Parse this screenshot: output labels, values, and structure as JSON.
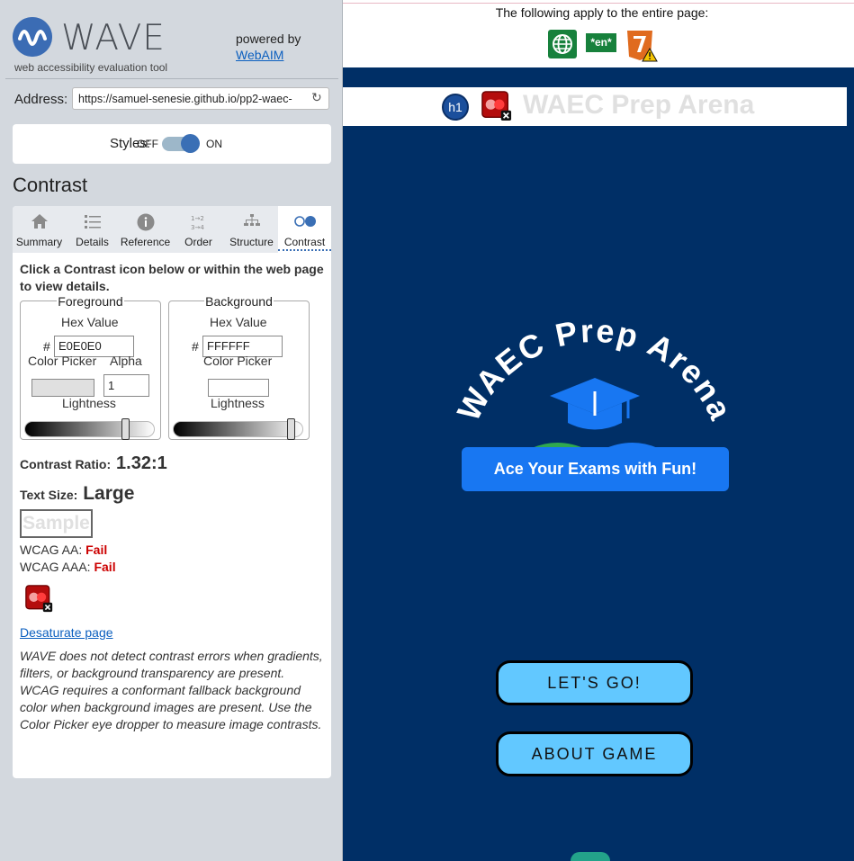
{
  "wave": {
    "logo_text": "WAVE",
    "tagline": "web accessibility evaluation tool",
    "powered_by": "powered by",
    "webaim_link": "WebAIM",
    "address_label": "Address:",
    "address_value": "https://samuel-senesie.github.io/pp2-waec-",
    "styles_label": "Styles:",
    "styles_off": "OFF",
    "styles_on": "ON",
    "panel_title": "Contrast",
    "tabs": [
      {
        "label": "Summary",
        "icon": "home-icon"
      },
      {
        "label": "Details",
        "icon": "list-icon"
      },
      {
        "label": "Reference",
        "icon": "info-icon"
      },
      {
        "label": "Order",
        "icon": "order-icon"
      },
      {
        "label": "Structure",
        "icon": "structure-icon"
      },
      {
        "label": "Contrast",
        "icon": "contrast-icon",
        "active": true
      }
    ],
    "intro": "Click a Contrast icon below or within the web page to view details.",
    "foreground": {
      "legend": "Foreground",
      "hex_label": "Hex Value",
      "hex_value": "E0E0E0",
      "picker_label": "Color Picker",
      "alpha_label": "Alpha",
      "alpha_value": "1",
      "lightness_label": "Lightness",
      "lightness": 0.8,
      "swatch_color": "#e0e0e0"
    },
    "background": {
      "legend": "Background",
      "hex_label": "Hex Value",
      "hex_value": "FFFFFF",
      "picker_label": "Color Picker",
      "lightness_label": "Lightness",
      "lightness": 0.94,
      "swatch_color": "#ffffff"
    },
    "hash": "#",
    "contrast_ratio_label": "Contrast Ratio:",
    "contrast_ratio_value": "1.32:1",
    "text_size_label": "Text Size:",
    "text_size_value": "Large",
    "sample_text": "Sample",
    "wcag_aa_label": "WCAG AA:",
    "wcag_aa_result": "Fail",
    "wcag_aaa_label": "WCAG AAA:",
    "wcag_aaa_result": "Fail",
    "desaturate_link": "Desaturate page",
    "note": "WAVE does not detect contrast errors when gradients, filters, or background transparency are present. WCAG requires a conformant fallback background color when background images are present. Use the Color Picker eye dropper to measure image contrasts."
  },
  "page": {
    "apply_text": "The following apply to the entire page:",
    "lang_badge": "*en*",
    "h1_badge": "h1",
    "site_title": "WAEC Prep Arena",
    "logo_arc_text": "WAEC Prep Arena",
    "tagline_button": "Ace Your Exams with  Fun!",
    "lets_go": "LET'S GO!",
    "about_game": "ABOUT GAME",
    "colors": {
      "site_bg": "#002f66",
      "tagline_bg": "#1877f2",
      "cta_bg": "#62c8ff",
      "error_red": "#c00000"
    }
  }
}
